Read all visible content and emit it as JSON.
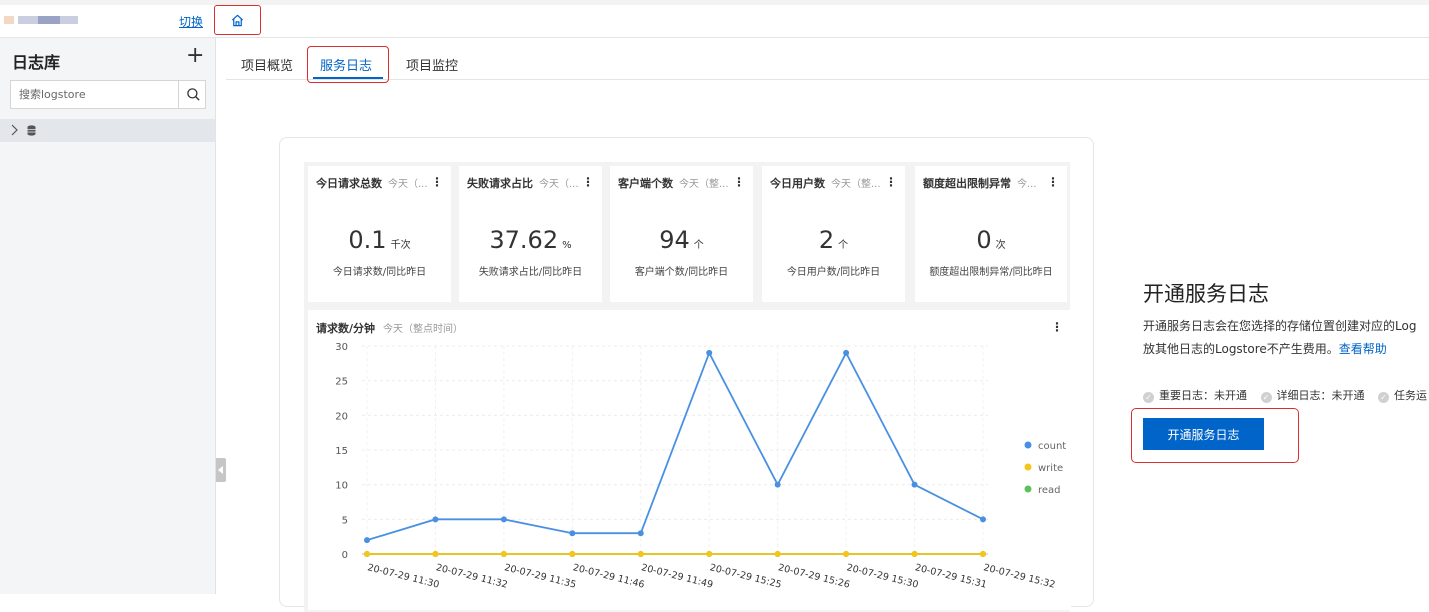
{
  "topbar": {
    "switch_label": "切换",
    "home_icon": "home-icon"
  },
  "sidebar": {
    "title": "日志库",
    "add_icon": "plus-icon",
    "search_placeholder": "搜索logstore",
    "search_icon": "search-icon",
    "tree_items": [
      {
        "icon": "database-icon",
        "label": ""
      }
    ]
  },
  "tabs": [
    {
      "label": "项目概览",
      "active": false
    },
    {
      "label": "服务日志",
      "active": true
    },
    {
      "label": "项目监控",
      "active": false
    }
  ],
  "preview": {
    "stats": [
      {
        "title": "今日请求总数",
        "subtitle": "今天（...",
        "value": "0.1",
        "unit": "千次",
        "caption": "今日请求数/同比昨日"
      },
      {
        "title": "失败请求占比",
        "subtitle": "今天（...",
        "value": "37.62",
        "unit": "%",
        "caption": "失败请求占比/同比昨日"
      },
      {
        "title": "客户端个数",
        "subtitle": "今天（整...",
        "value": "94",
        "unit": "个",
        "caption": "客户端个数/同比昨日"
      },
      {
        "title": "今日用户数",
        "subtitle": "今天（整...",
        "value": "2",
        "unit": "个",
        "caption": "今日用户数/同比昨日"
      },
      {
        "title": "额度超出限制异常",
        "subtitle": "今...",
        "value": "0",
        "unit": "次",
        "caption": "额度超出限制异常/同比昨日"
      }
    ],
    "chart_title": "请求数/分钟",
    "chart_subtitle": "今天（整点时间）"
  },
  "chart_data": {
    "type": "line",
    "title": "请求数/分钟",
    "subtitle": "今天（整点时间）",
    "categories": [
      "20-07-29 11:30",
      "20-07-29 11:32",
      "20-07-29 11:35",
      "20-07-29 11:46",
      "20-07-29 11:49",
      "20-07-29 15:25",
      "20-07-29 15:26",
      "20-07-29 15:30",
      "20-07-29 15:31",
      "20-07-29 15:32"
    ],
    "series": [
      {
        "name": "count",
        "color": "#4a90e2",
        "values": [
          2,
          5,
          5,
          3,
          3,
          29,
          10,
          29,
          10,
          5
        ]
      },
      {
        "name": "write",
        "color": "#f5c518",
        "values": [
          0,
          0,
          0,
          0,
          0,
          0,
          0,
          0,
          0,
          0
        ]
      },
      {
        "name": "read",
        "color": "#5cc15c",
        "values": [
          0,
          0,
          0,
          0,
          0,
          0,
          0,
          0,
          0,
          0
        ]
      }
    ],
    "yticks": [
      0,
      5,
      10,
      15,
      20,
      25,
      30
    ],
    "ylim": [
      0,
      30
    ],
    "grid": true,
    "legend": "right"
  },
  "promo": {
    "heading": "开通服务日志",
    "desc_line1": "开通服务日志会在您选择的存储位置创建对应的Log",
    "desc_line2": "放其他日志的Logstore不产生费用。",
    "help_link": "查看帮助",
    "status": [
      {
        "label": "重要日志：未开通"
      },
      {
        "label": "详细日志：未开通"
      },
      {
        "label": "任务运"
      }
    ],
    "cta_label": "开通服务日志"
  },
  "colors": {
    "accent": "#0064c8",
    "annotation": "#d9302f"
  }
}
